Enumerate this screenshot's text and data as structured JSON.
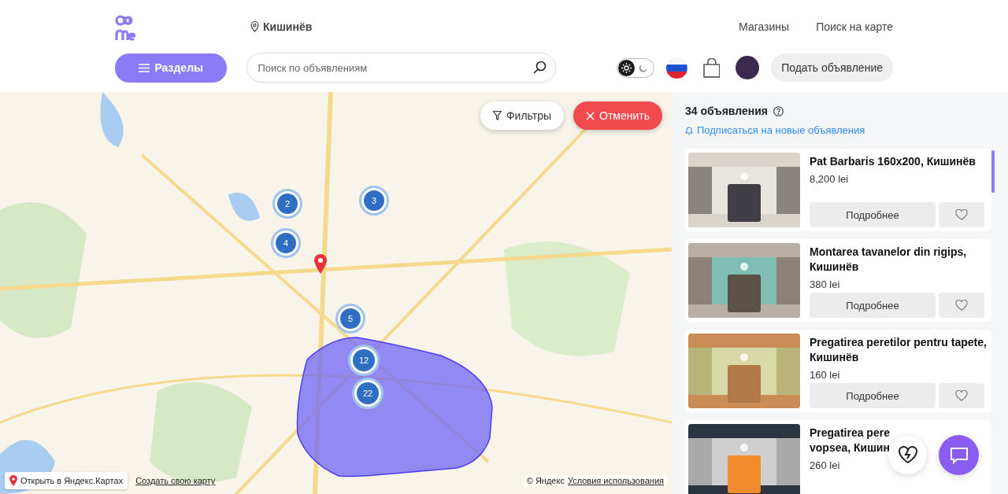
{
  "header": {
    "city": "Кишинёв",
    "nav": [
      "Магазины",
      "Поиск на карте"
    ],
    "sections_button": "Разделы",
    "search": {
      "placeholder": "Поиск по объявлениям"
    },
    "theme_toggle": {
      "dark": false
    },
    "post_button": "Подать объявление"
  },
  "map": {
    "filters_button": "Фильтры",
    "cancel_button": "Отменить",
    "clusters": [
      {
        "count": "2"
      },
      {
        "count": "3"
      },
      {
        "count": "4"
      },
      {
        "count": "5"
      },
      {
        "count": "12"
      },
      {
        "count": "22"
      }
    ],
    "open_link": "Открыть в Яндекс.Картах",
    "create_link": "Создать свою карту",
    "copyright": "© Яндекс",
    "terms_link": "Условия использования"
  },
  "results": {
    "count": "34 объявления",
    "subscribe_link": "Подписаться на новые объявления",
    "listings": [
      {
        "title": "Pat Barbaris 160x200, Кишинёв",
        "price": "8,200 lei",
        "details_button": "Подробнее"
      },
      {
        "title": "Montarea tavanelor din rigips, Кишинёв",
        "price": "380 lei",
        "details_button": "Подробнее"
      },
      {
        "title": "Pregatirea peretilor pentru tapete, Кишинёв",
        "price": "160 lei",
        "details_button": "Подробнее"
      },
      {
        "title": "Pregatirea pere",
        "title_line_2": "vopsea, Кишин",
        "price": "260 lei"
      }
    ]
  }
}
